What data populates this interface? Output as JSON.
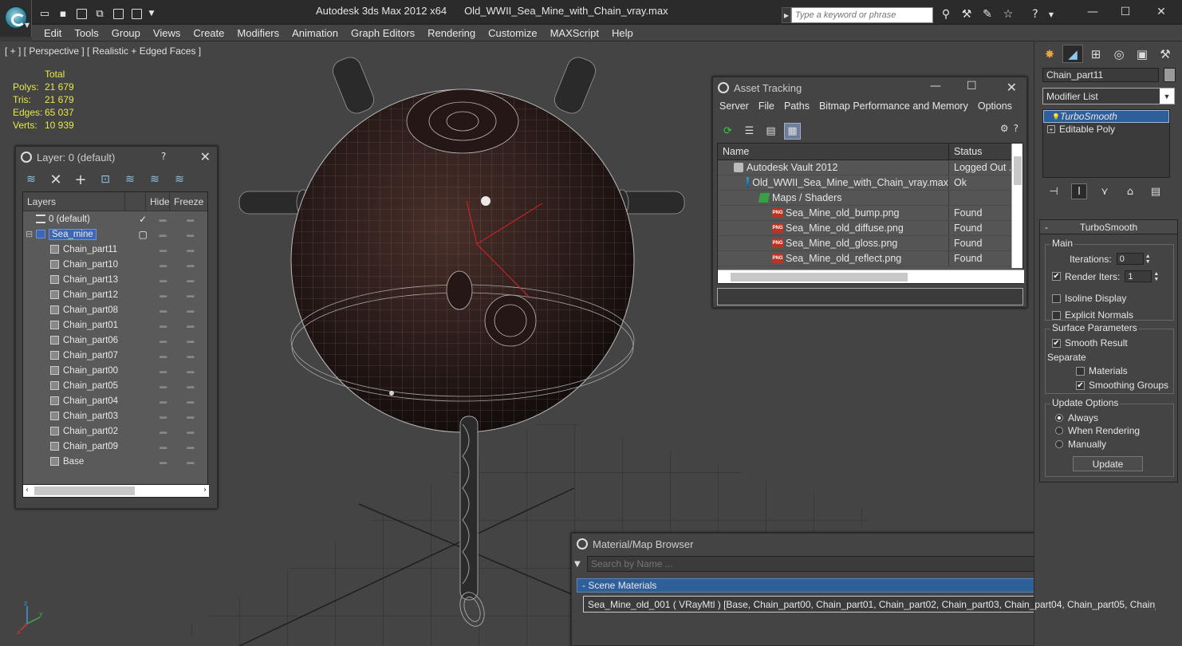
{
  "title_bar": {
    "app": "Autodesk 3ds Max  2012 x64",
    "file": "Old_WWII_Sea_Mine_with_Chain_vray.max",
    "search_placeholder": "Type a keyword or phrase"
  },
  "menu": [
    "Edit",
    "Tools",
    "Group",
    "Views",
    "Create",
    "Modifiers",
    "Animation",
    "Graph Editors",
    "Rendering",
    "Customize",
    "MAXScript",
    "Help"
  ],
  "viewport": {
    "label": "[ + ] [ Perspective ] [ Realistic + Edged Faces ]",
    "stats_header": "Total",
    "stats": [
      {
        "k": "Polys:",
        "v": "21 679"
      },
      {
        "k": "Tris:",
        "v": "21 679"
      },
      {
        "k": "Edges:",
        "v": "65 037"
      },
      {
        "k": "Verts:",
        "v": "10 939"
      }
    ],
    "axis_labels": {
      "x": "x",
      "y": "y",
      "z": "z"
    }
  },
  "layer_panel": {
    "title": "Layer: 0 (default)",
    "help": "?",
    "columns": {
      "layers": "Layers",
      "hide": "Hide",
      "freeze": "Freeze"
    },
    "rows": [
      {
        "name": "0 (default)",
        "type": "layer"
      },
      {
        "name": "Sea_mine",
        "type": "layer"
      },
      {
        "name": "Chain_part11",
        "type": "object"
      },
      {
        "name": "Chain_part10",
        "type": "object"
      },
      {
        "name": "Chain_part13",
        "type": "object"
      },
      {
        "name": "Chain_part12",
        "type": "object"
      },
      {
        "name": "Chain_part08",
        "type": "object"
      },
      {
        "name": "Chain_part01",
        "type": "object"
      },
      {
        "name": "Chain_part06",
        "type": "object"
      },
      {
        "name": "Chain_part07",
        "type": "object"
      },
      {
        "name": "Chain_part00",
        "type": "object"
      },
      {
        "name": "Chain_part05",
        "type": "object"
      },
      {
        "name": "Chain_part04",
        "type": "object"
      },
      {
        "name": "Chain_part03",
        "type": "object"
      },
      {
        "name": "Chain_part02",
        "type": "object"
      },
      {
        "name": "Chain_part09",
        "type": "object"
      },
      {
        "name": "Base",
        "type": "object"
      }
    ]
  },
  "asset_panel": {
    "title": "Asset Tracking",
    "menu": [
      "Server",
      "File",
      "Paths",
      "Bitmap Performance and Memory",
      "Options"
    ],
    "columns": {
      "name": "Name",
      "status": "Status"
    },
    "rows": [
      {
        "name": "Autodesk Vault 2012",
        "status": "Logged Out ...",
        "icon": "vault-icon",
        "indent": 1
      },
      {
        "name": "Old_WWII_Sea_Mine_with_Chain_vray.max",
        "status": "Ok",
        "icon": "max-file-icon",
        "indent": 2
      },
      {
        "name": "Maps / Shaders",
        "status": "",
        "icon": "maps-icon",
        "indent": 3
      },
      {
        "name": "Sea_Mine_old_bump.png",
        "status": "Found",
        "icon": "png-icon",
        "indent": 4
      },
      {
        "name": "Sea_Mine_old_diffuse.png",
        "status": "Found",
        "icon": "png-icon",
        "indent": 4
      },
      {
        "name": "Sea_Mine_old_gloss.png",
        "status": "Found",
        "icon": "png-icon",
        "indent": 4
      },
      {
        "name": "Sea_Mine_old_reflect.png",
        "status": "Found",
        "icon": "png-icon",
        "indent": 4
      }
    ],
    "png_label": "PNG"
  },
  "material_browser": {
    "title": "Material/Map Browser",
    "search_placeholder": "Search by Name ...",
    "category": "- Scene Materials",
    "item": "Sea_Mine_old_001  ( VRayMtl )  [Base, Chain_part00, Chain_part01, Chain_part02, Chain_part03, Chain_part04, Chain_part05, Chain_part0..."
  },
  "command_panel": {
    "object_name": "Chain_part11",
    "modifier_list": "Modifier List",
    "stack": [
      {
        "label": "TurboSmooth",
        "selected": true
      },
      {
        "label": "Editable Poly",
        "selected": false
      }
    ],
    "rollout_title": "TurboSmooth",
    "rollout_toggle": "-",
    "main_group": "Main",
    "iterations_label": "Iterations:",
    "iterations_value": "0",
    "render_iters_label": "Render Iters:",
    "render_iters_value": "1",
    "render_iters_checked": true,
    "isoline_label": "Isoline Display",
    "explicit_label": "Explicit Normals",
    "surface_group": "Surface Parameters",
    "smooth_result_label": "Smooth Result",
    "separate_label": "Separate",
    "materials_label": "Materials",
    "smoothing_groups_label": "Smoothing Groups",
    "update_group": "Update Options",
    "always_label": "Always",
    "when_rendering_label": "When Rendering",
    "manually_label": "Manually",
    "update_button": "Update"
  }
}
